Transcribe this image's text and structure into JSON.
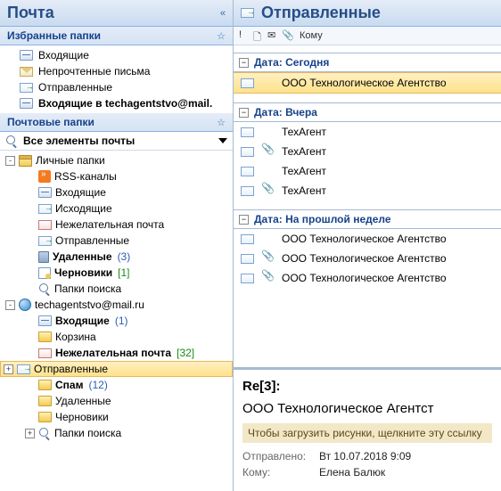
{
  "left": {
    "title": "Почта",
    "fav_header": "Избранные папки",
    "favorites": [
      {
        "icon": "inbox",
        "label": "Входящие"
      },
      {
        "icon": "envelope",
        "label": "Непрочтенные письма"
      },
      {
        "icon": "sent",
        "label": "Отправленные"
      },
      {
        "icon": "inbox",
        "label": "Входящие в techagentstvo@mail.",
        "bold": true
      }
    ],
    "mail_header": "Почтовые папки",
    "search_label": "Все элементы почты",
    "tree": [
      {
        "level": 0,
        "exp": "-",
        "icon": "store",
        "label": "Личные папки"
      },
      {
        "level": 1,
        "exp": "",
        "icon": "rss",
        "label": "RSS-каналы"
      },
      {
        "level": 1,
        "exp": "",
        "icon": "inbox",
        "label": "Входящие"
      },
      {
        "level": 1,
        "exp": "",
        "icon": "sent",
        "label": "Исходящие"
      },
      {
        "level": 1,
        "exp": "",
        "icon": "junk",
        "label": "Нежелательная почта"
      },
      {
        "level": 1,
        "exp": "",
        "icon": "sent",
        "label": "Отправленные"
      },
      {
        "level": 1,
        "exp": "",
        "icon": "trash",
        "label": "Удаленные",
        "bold": true,
        "count": "(3)"
      },
      {
        "level": 1,
        "exp": "",
        "icon": "draft",
        "label": "Черновики",
        "bold": true,
        "count": "[1]",
        "countColor": "green"
      },
      {
        "level": 1,
        "exp": "",
        "icon": "search",
        "label": "Папки поиска"
      },
      {
        "level": 0,
        "exp": "-",
        "icon": "globe",
        "label": "techagentstvo@mail.ru"
      },
      {
        "level": 1,
        "exp": "",
        "icon": "inbox",
        "label": "Входящие",
        "bold": true,
        "count": "(1)"
      },
      {
        "level": 1,
        "exp": "",
        "icon": "folder",
        "label": "Корзина"
      },
      {
        "level": 1,
        "exp": "",
        "icon": "junk",
        "label": "Нежелательная почта",
        "bold": true,
        "count": "[32]",
        "countColor": "green"
      },
      {
        "level": 1,
        "exp": "+",
        "icon": "sent",
        "label": "Отправленные",
        "selected": true
      },
      {
        "level": 1,
        "exp": "",
        "icon": "folder",
        "label": "Спам",
        "bold": true,
        "count": "(12)"
      },
      {
        "level": 1,
        "exp": "",
        "icon": "folder",
        "label": "Удаленные"
      },
      {
        "level": 1,
        "exp": "",
        "icon": "folder",
        "label": "Черновики"
      },
      {
        "level": 1,
        "exp": "+",
        "icon": "search",
        "label": "Папки поиска"
      }
    ]
  },
  "right": {
    "title": "Отправленные",
    "col_to": "Кому",
    "groups": [
      {
        "label": "Дата: Сегодня",
        "rows": [
          {
            "icon": "envelope-open",
            "att": false,
            "to": "ООО Технологическое Агентство",
            "selected": true
          }
        ]
      },
      {
        "label": "Дата: Вчера",
        "rows": [
          {
            "icon": "envelope-open",
            "att": false,
            "to": "ТехАгент"
          },
          {
            "icon": "envelope-open",
            "att": true,
            "to": "ТехАгент"
          },
          {
            "icon": "envelope-open",
            "att": false,
            "to": "ТехАгент"
          },
          {
            "icon": "envelope-open",
            "att": true,
            "to": "ТехАгент"
          }
        ]
      },
      {
        "label": "Дата: На прошлой неделе",
        "rows": [
          {
            "icon": "envelope-open",
            "att": false,
            "to": "ООО Технологическое Агентство"
          },
          {
            "icon": "envelope-open",
            "att": true,
            "to": "ООО Технологическое Агентство"
          },
          {
            "icon": "envelope-open",
            "att": true,
            "to": "ООО Технологическое Агентство"
          }
        ]
      }
    ],
    "preview": {
      "subject": "Re[3]:",
      "to": "ООО Технологическое Агентст",
      "infobar": "Чтобы загрузить рисунки, щелкните эту ссылку",
      "sent_label": "Отправлено:",
      "sent_value": "Вт 10.07.2018 9:09",
      "to_label": "Кому:",
      "to_value": "Елена Балюк"
    }
  }
}
